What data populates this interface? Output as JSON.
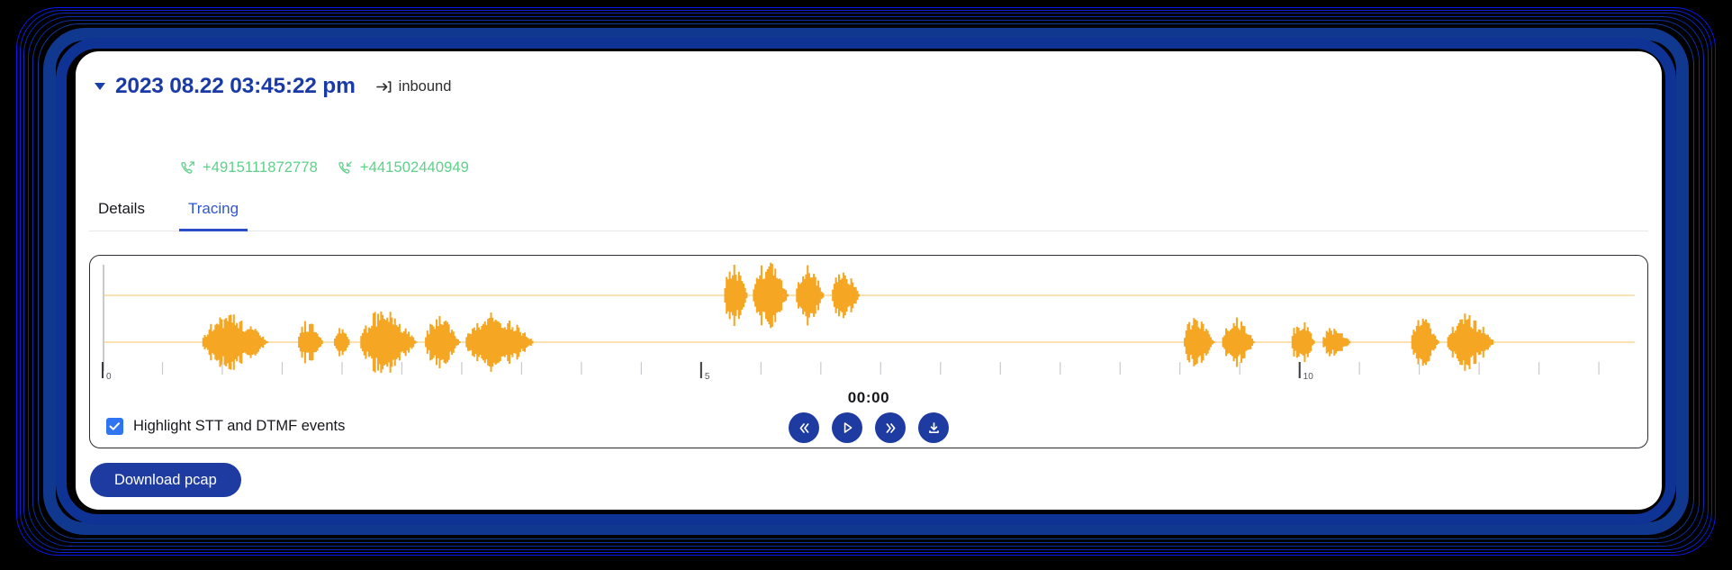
{
  "theme": {
    "page_background": "#000000",
    "card_background": "#ffffff",
    "brand_navy": "#1d3ba0",
    "tab_active_blue": "#2f55d4",
    "phone_green": "#5fd08a",
    "waveform_amber": "#f5a623",
    "waveform_baseline": "#fbd89a",
    "checkbox_blue": "#2f74f0",
    "panel_border": "#2b2b33",
    "glow_colors": [
      "#0b17ee",
      "#0f2ad0",
      "#0d28b4",
      "#0c2aa6",
      "#0b2f9e",
      "#123a96"
    ]
  },
  "header": {
    "collapse_icon": "caret-down-icon",
    "title": "2023 08.22 03:45:22 pm",
    "direction_icon": "arrow-into-bracket-icon",
    "direction": "inbound",
    "numbers": [
      {
        "icon": "phone-outgoing-icon",
        "value": "+4915111872778"
      },
      {
        "icon": "phone-incoming-icon",
        "value": "+441502440949"
      }
    ]
  },
  "tabs": [
    {
      "label": "Details",
      "active": false
    },
    {
      "label": "Tracing",
      "active": true
    }
  ],
  "tracing": {
    "playhead_position_seconds": 0,
    "timecode": "00:00",
    "controls": [
      {
        "name": "rewind-button",
        "icon": "double-chevron-left-icon",
        "label": "«"
      },
      {
        "name": "play-button",
        "icon": "play-triangle-icon",
        "label": "▷"
      },
      {
        "name": "forward-button",
        "icon": "double-chevron-right-icon",
        "label": "»"
      },
      {
        "name": "download-audio-button",
        "icon": "download-tray-icon",
        "label": ""
      }
    ],
    "highlight_checkbox": {
      "checked": true,
      "label": "Highlight STT and DTMF events"
    }
  },
  "chart_data": {
    "type": "line",
    "title": "Call audio waveform (two channels)",
    "xlabel": "",
    "ylabel": "",
    "xlim": [
      0,
      12.8
    ],
    "tick_labels": [
      "0",
      "5",
      "10"
    ],
    "tick_label_positions": [
      0,
      5,
      10
    ],
    "minor_tick_interval": 0.5,
    "grid": false,
    "legend": "none",
    "series": [
      {
        "name": "channel-upper",
        "baseline_y": 0.0,
        "color": "#f5a623",
        "segments": [
          {
            "start": 5.18,
            "end": 5.38,
            "peak": 0.88
          },
          {
            "start": 5.42,
            "end": 5.72,
            "peak": 1.0
          },
          {
            "start": 5.78,
            "end": 6.02,
            "peak": 0.94
          },
          {
            "start": 6.08,
            "end": 6.32,
            "peak": 0.72
          }
        ]
      },
      {
        "name": "channel-lower",
        "baseline_y": 0.0,
        "color": "#f5a623",
        "segments": [
          {
            "start": 0.82,
            "end": 1.38,
            "peak": 0.8
          },
          {
            "start": 1.62,
            "end": 1.84,
            "peak": 0.62
          },
          {
            "start": 1.92,
            "end": 2.06,
            "peak": 0.46
          },
          {
            "start": 2.14,
            "end": 2.62,
            "peak": 0.92
          },
          {
            "start": 2.68,
            "end": 2.98,
            "peak": 0.78
          },
          {
            "start": 3.02,
            "end": 3.6,
            "peak": 0.86
          },
          {
            "start": 9.02,
            "end": 9.28,
            "peak": 0.74
          },
          {
            "start": 9.34,
            "end": 9.62,
            "peak": 0.7
          },
          {
            "start": 9.92,
            "end": 10.12,
            "peak": 0.66
          },
          {
            "start": 10.18,
            "end": 10.42,
            "peak": 0.44
          },
          {
            "start": 10.92,
            "end": 11.16,
            "peak": 0.72
          },
          {
            "start": 11.22,
            "end": 11.62,
            "peak": 0.8
          }
        ]
      }
    ]
  },
  "footer": {
    "download_pcap_label": "Download pcap"
  }
}
